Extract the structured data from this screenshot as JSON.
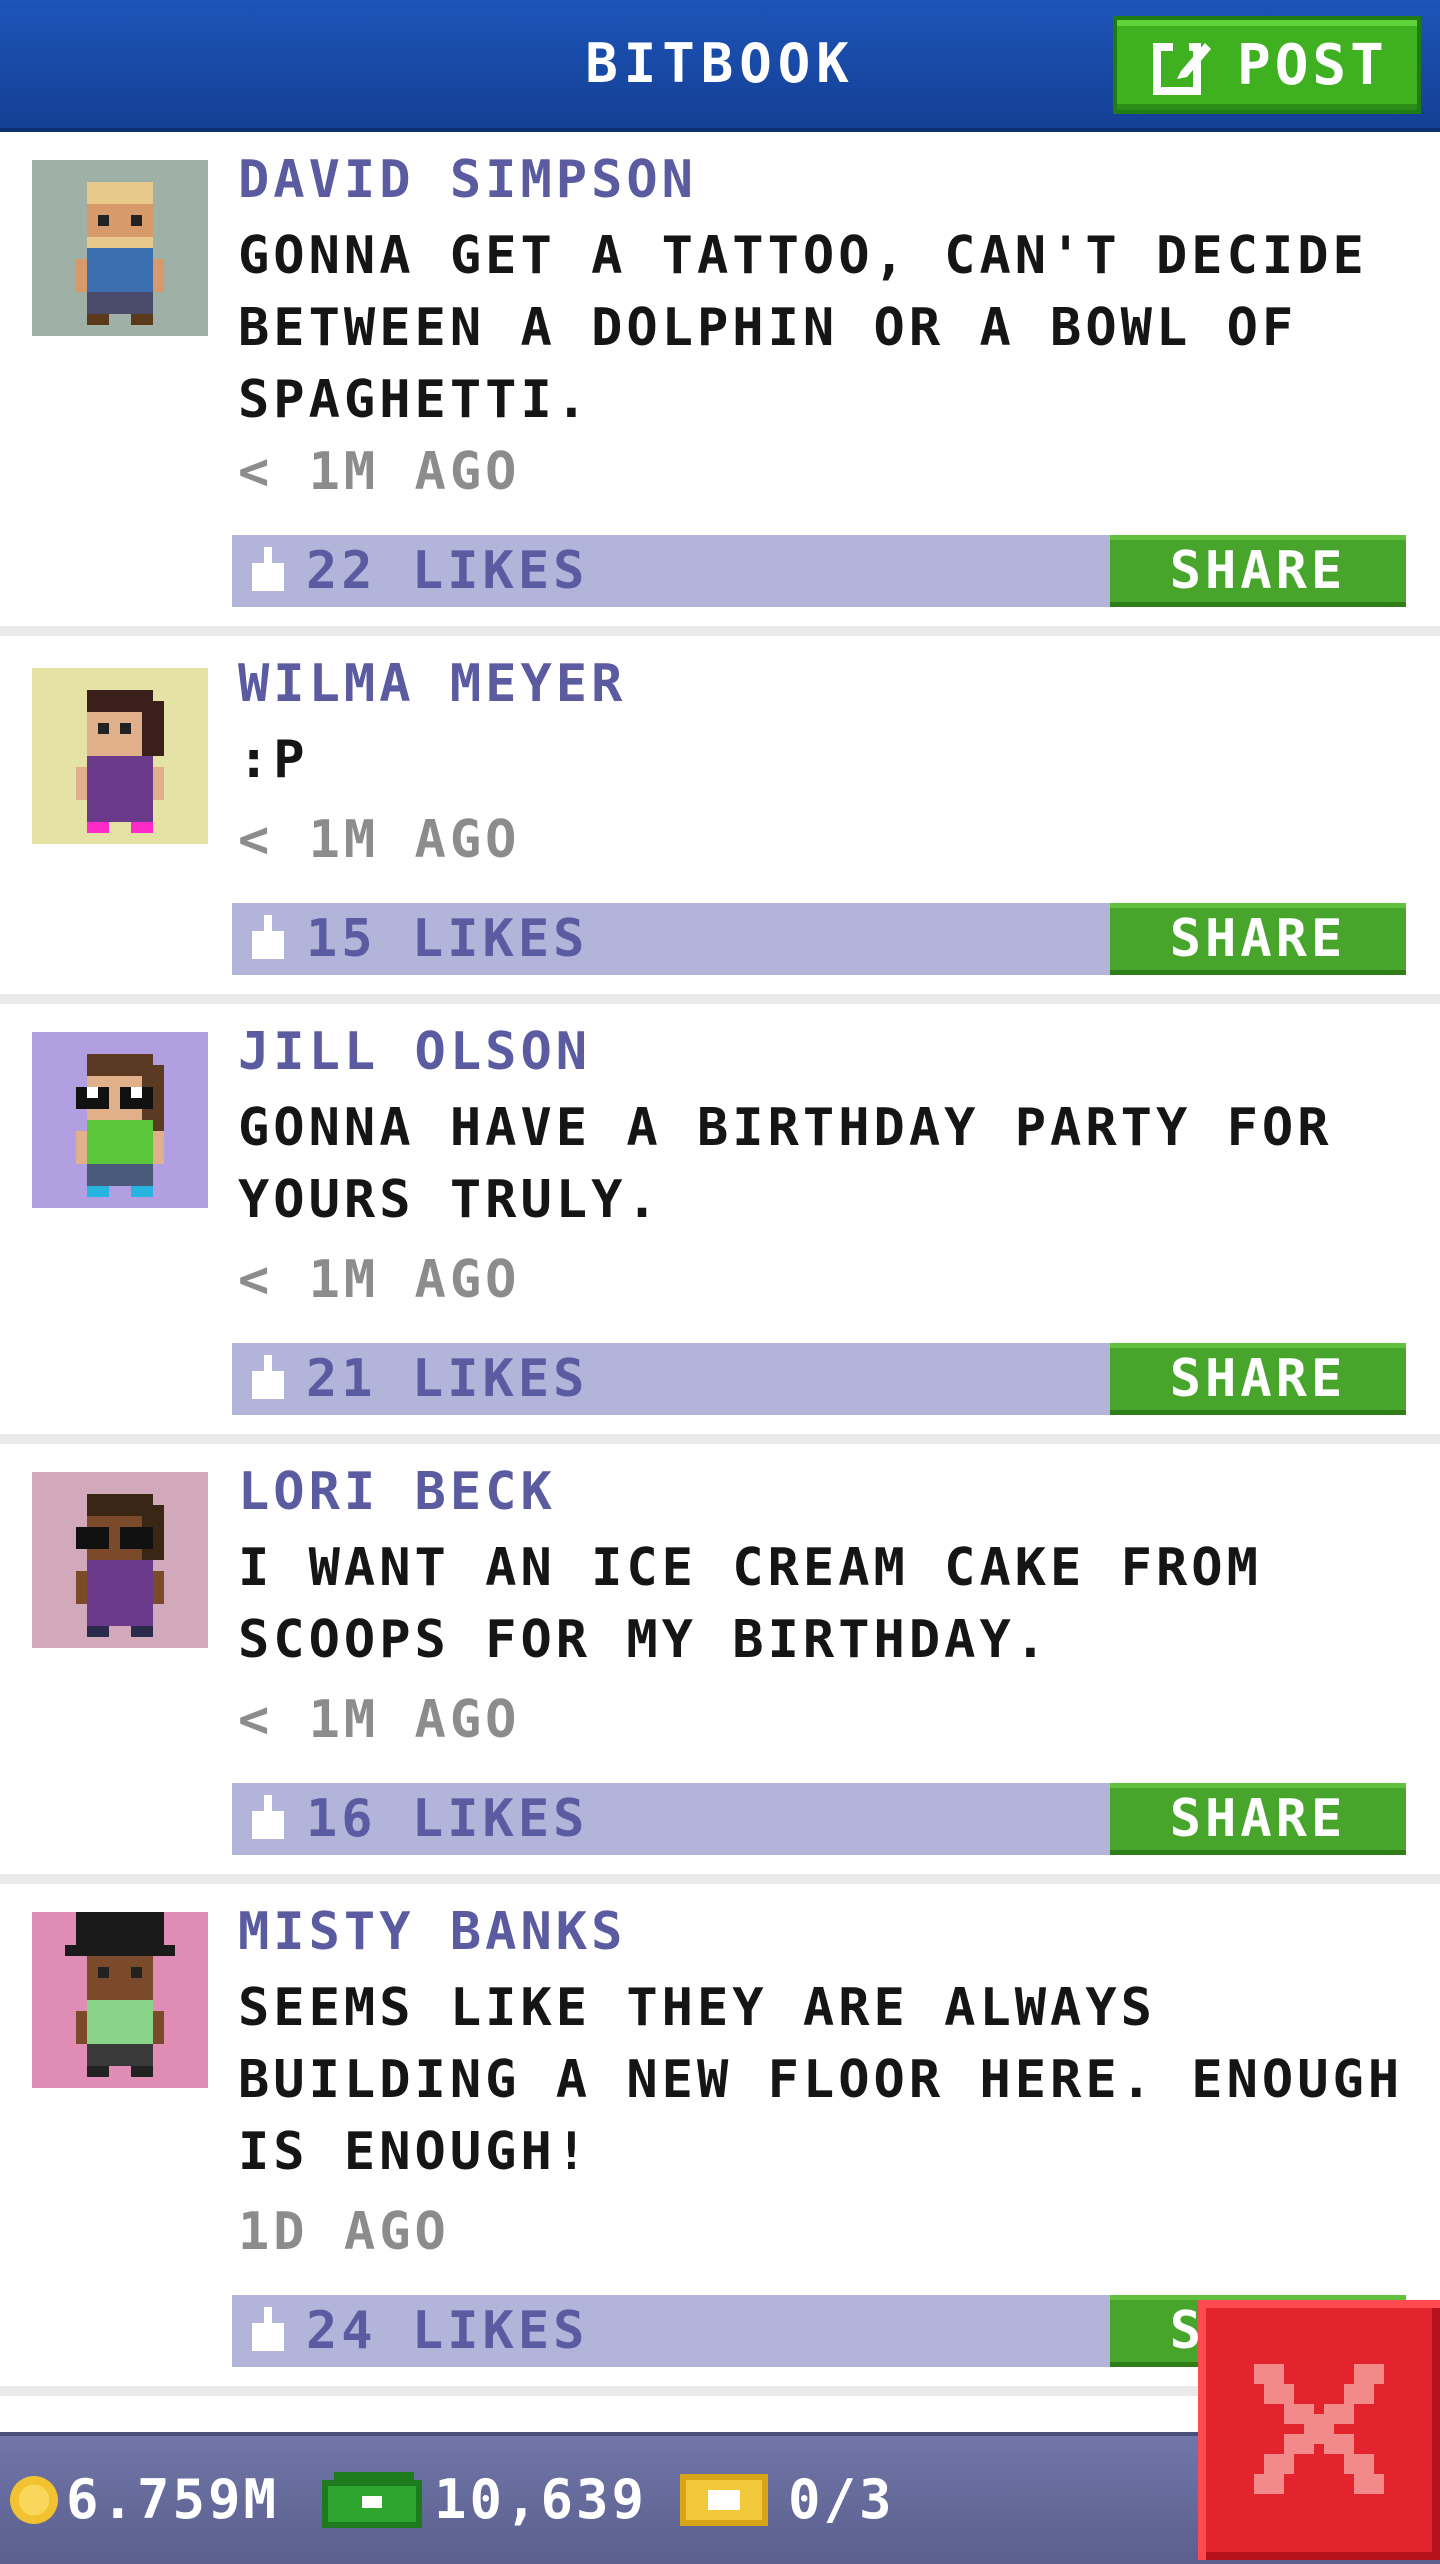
{
  "header": {
    "title": "BITBOOK",
    "post_label": "POST"
  },
  "posts": [
    {
      "author": "DAVID SIMPSON",
      "text": "GONNA GET A TATTOO, CAN'T DECIDE BETWEEN A DOLPHIN OR A BOWL OF SPAGHETTI.",
      "time": "< 1M AGO",
      "likes": "22 LIKES",
      "share": "SHARE",
      "avatar_bg": "#9fb1a6"
    },
    {
      "author": "WILMA MEYER",
      "text": ":P",
      "time": "< 1M AGO",
      "likes": "15 LIKES",
      "share": "SHARE",
      "avatar_bg": "#e5e2a6"
    },
    {
      "author": "JILL OLSON",
      "text": "GONNA HAVE A BIRTHDAY PARTY FOR YOURS TRULY.",
      "time": "< 1M AGO",
      "likes": "21 LIKES",
      "share": "SHARE",
      "avatar_bg": "#b19fe1"
    },
    {
      "author": "LORI BECK",
      "text": "I WANT AN ICE CREAM CAKE FROM SCOOPS FOR MY BIRTHDAY.",
      "time": "< 1M AGO",
      "likes": "16 LIKES",
      "share": "SHARE",
      "avatar_bg": "#d2a9bb"
    },
    {
      "author": "MISTY BANKS",
      "text": "SEEMS LIKE THEY ARE ALWAYS BUILDING A NEW FLOOR HERE. ENOUGH IS ENOUGH!",
      "time": "1D AGO",
      "likes": "24 LIKES",
      "share": "SHARE",
      "avatar_bg": "#e08db6"
    }
  ],
  "status_bar": {
    "coins": "6.759M",
    "bux": "10,639",
    "vip": "0/3"
  },
  "icons": {
    "post": "edit-icon",
    "like": "thumbs-up-icon",
    "coin": "coin-icon",
    "bux": "cash-icon",
    "vip": "vip-ticket-icon",
    "close": "close-icon"
  },
  "colors": {
    "header": "#1d55b8",
    "post_button": "#3fb020",
    "share_button": "#47a52b",
    "action_bar": "#b2b5d9",
    "author_text": "#5a5ba0",
    "bottom_bar": "#6a6f9f",
    "close_button": "#e3242e"
  }
}
